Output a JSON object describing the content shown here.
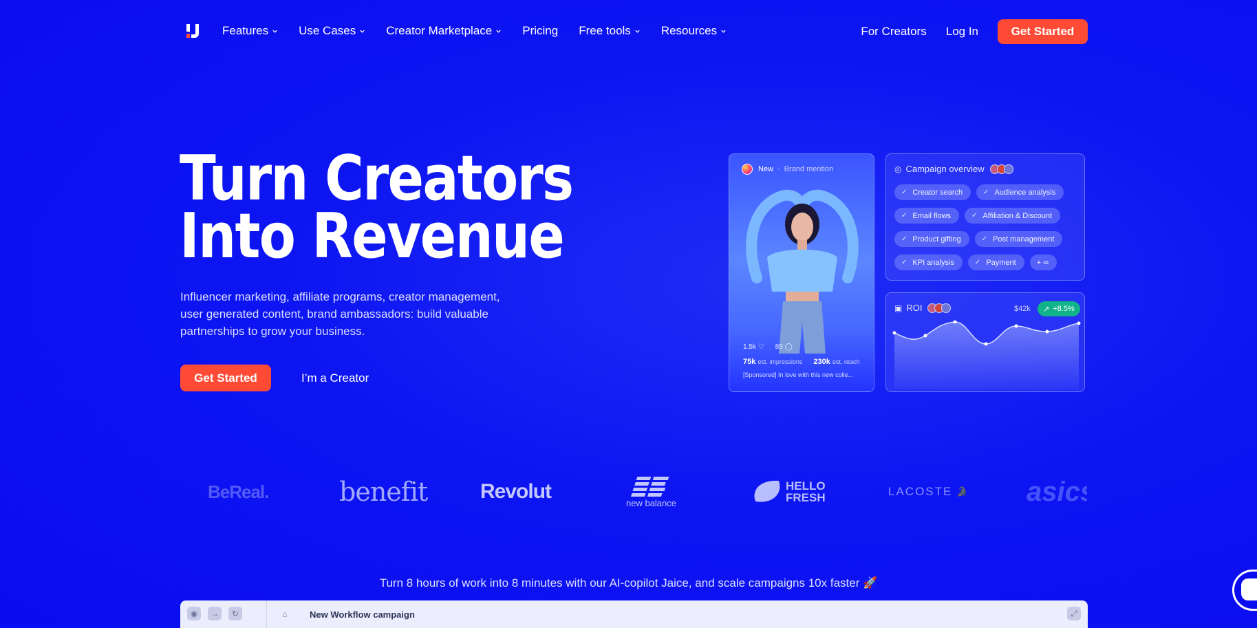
{
  "nav": {
    "menu": [
      {
        "label": "Features",
        "dropdown": true
      },
      {
        "label": "Use Cases",
        "dropdown": true
      },
      {
        "label": "Creator Marketplace",
        "dropdown": true
      },
      {
        "label": "Pricing",
        "dropdown": false
      },
      {
        "label": "Free tools",
        "dropdown": true
      },
      {
        "label": "Resources",
        "dropdown": true
      }
    ],
    "for_creators": "For Creators",
    "login": "Log In",
    "cta": "Get Started"
  },
  "hero": {
    "title_line1": "Turn Creators",
    "title_line2": "Into Revenue",
    "subtitle": "Influencer marketing, affiliate programs, creator management, user generated content, brand ambassadors: build valuable partnerships to grow your business.",
    "cta": "Get Started",
    "creator_link": "I’m a Creator"
  },
  "post_card": {
    "new_label": "New",
    "separator": "·",
    "mention_label": "Brand mention",
    "likes": "1.5k",
    "comments": "85",
    "impressions_value": "75k",
    "impressions_label": "est. impressions",
    "reach_value": "230k",
    "reach_label": "est. reach",
    "caption": "[Sponsored] In love with this new colle..."
  },
  "campaign_card": {
    "title": "Campaign overview",
    "chips": [
      "Creator search",
      "Audience analysis",
      "Email flows",
      "Affiliation & Discount",
      "Product gifting",
      "Post management",
      "KPI analysis",
      "Payment"
    ],
    "more_chip": "+ ∞"
  },
  "roi_card": {
    "title": "ROI",
    "amount": "$42k",
    "change": "+8.5%"
  },
  "logos": [
    "BeReal.",
    "benefit",
    "Revolut",
    "new balance",
    "HELLO",
    "FRESH",
    "LACOSTE",
    "asics"
  ],
  "tagline": "Turn 8 hours of work into 8 minutes with our AI-copilot Jaice, and scale campaigns 10x faster 🚀",
  "browser": {
    "title": "New Workflow campaign"
  },
  "colors": {
    "background": "#0a0cf0",
    "accent": "#ff4b36",
    "roi_badge": "#11b38a"
  }
}
